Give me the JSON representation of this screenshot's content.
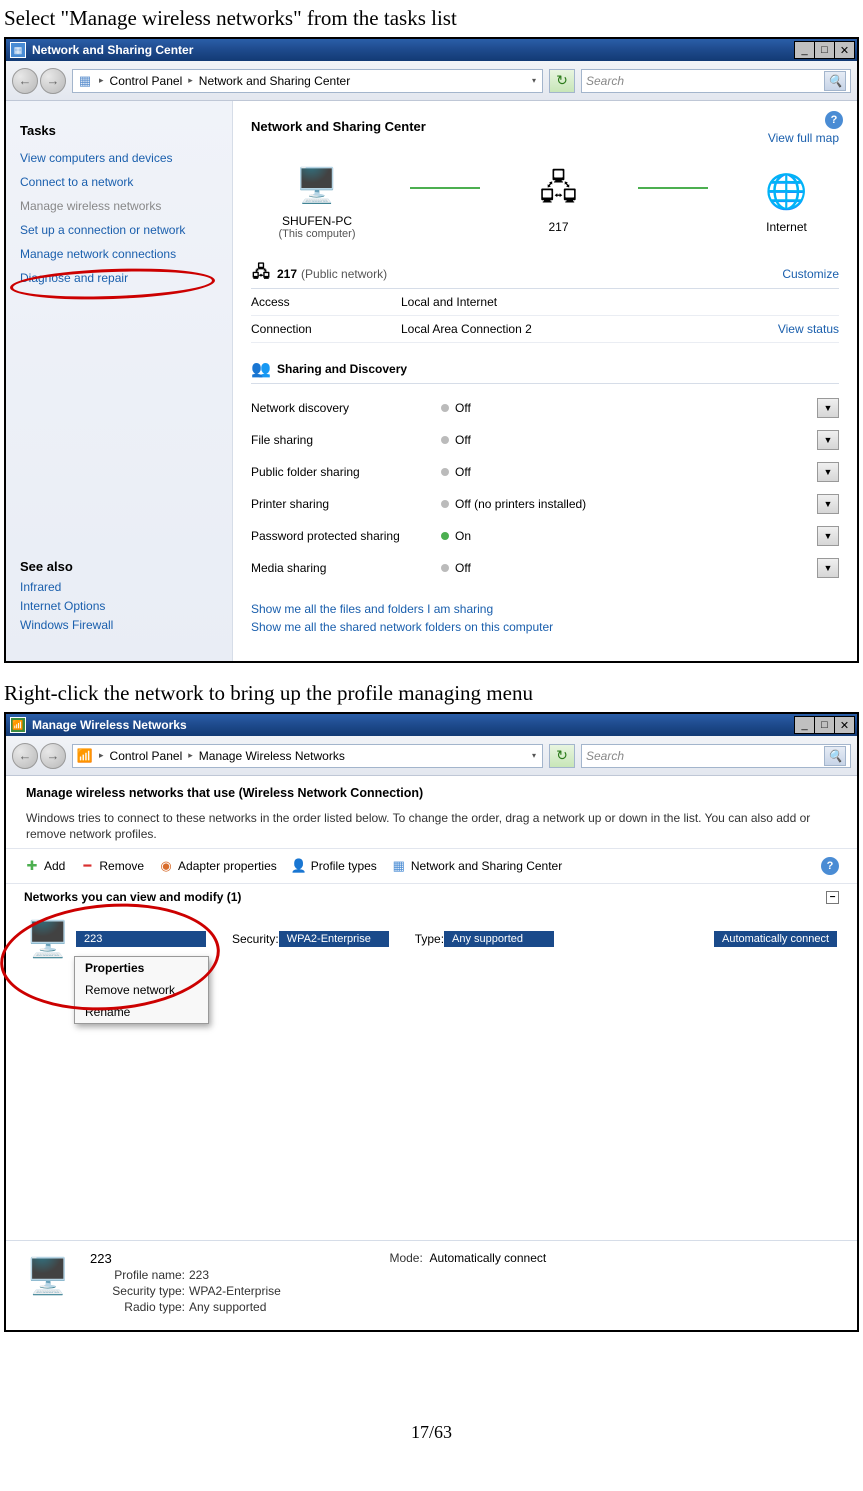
{
  "instructions": {
    "step1": "Select \"Manage wireless networks\" from the tasks list",
    "step2": "Right-click the network to bring up the profile managing menu"
  },
  "page_number": "17/63",
  "window1": {
    "title": "Network and Sharing Center",
    "breadcrumbs": [
      "Control Panel",
      "Network and Sharing Center"
    ],
    "search_placeholder": "Search",
    "tasks_heading": "Tasks",
    "tasks": [
      "View computers and devices",
      "Connect to a network",
      "Manage wireless networks",
      "Set up a connection or network",
      "Manage network connections",
      "Diagnose and repair"
    ],
    "see_also_heading": "See also",
    "see_also": [
      "Infrared",
      "Internet Options",
      "Windows Firewall"
    ],
    "main_title": "Network and Sharing Center",
    "view_full_map": "View full map",
    "map": {
      "node1": "SHUFEN-PC",
      "node1_sub": "(This computer)",
      "node2": "217",
      "node3": "Internet"
    },
    "net_section": {
      "name": "217",
      "paren": "(Public network)",
      "customize": "Customize",
      "rows": [
        {
          "k": "Access",
          "v": "Local and Internet",
          "link": ""
        },
        {
          "k": "Connection",
          "v": "Local Area Connection 2",
          "link": "View status"
        }
      ]
    },
    "sd_section": {
      "title": "Sharing and Discovery",
      "rows": [
        {
          "k": "Network discovery",
          "v": "Off",
          "on": false
        },
        {
          "k": "File sharing",
          "v": "Off",
          "on": false
        },
        {
          "k": "Public folder sharing",
          "v": "Off",
          "on": false
        },
        {
          "k": "Printer sharing",
          "v": "Off (no printers installed)",
          "on": false
        },
        {
          "k": "Password protected sharing",
          "v": "On",
          "on": true
        },
        {
          "k": "Media sharing",
          "v": "Off",
          "on": false
        }
      ]
    },
    "footlinks": [
      "Show me all the files and folders I am sharing",
      "Show me all the shared network folders on this computer"
    ]
  },
  "window2": {
    "title": "Manage Wireless Networks",
    "breadcrumbs": [
      "Control Panel",
      "Manage Wireless Networks"
    ],
    "search_placeholder": "Search",
    "instructions_title": "Manage wireless networks that use (Wireless Network Connection)",
    "instructions_desc": "Windows tries to connect to these networks in the order listed below. To change the order, drag a network up or down in the list. You can also add or remove network profiles.",
    "toolbar": {
      "add": "Add",
      "remove": "Remove",
      "adapter": "Adapter properties",
      "profile": "Profile types",
      "center": "Network and Sharing Center"
    },
    "list_heading": "Networks you can view and modify (1)",
    "network": {
      "name": "223",
      "security_label": "Security:",
      "security": "WPA2-Enterprise",
      "type_label": "Type:",
      "type": "Any supported",
      "auto": "Automatically connect"
    },
    "context_menu": [
      "Properties",
      "Remove network",
      "Rename"
    ],
    "footer": {
      "name": "223",
      "profile_label": "Profile name:",
      "profile": "223",
      "sectype_label": "Security type:",
      "sectype": "WPA2-Enterprise",
      "radio_label": "Radio type:",
      "radio": "Any supported",
      "mode_label": "Mode:",
      "mode": "Automatically connect"
    }
  }
}
